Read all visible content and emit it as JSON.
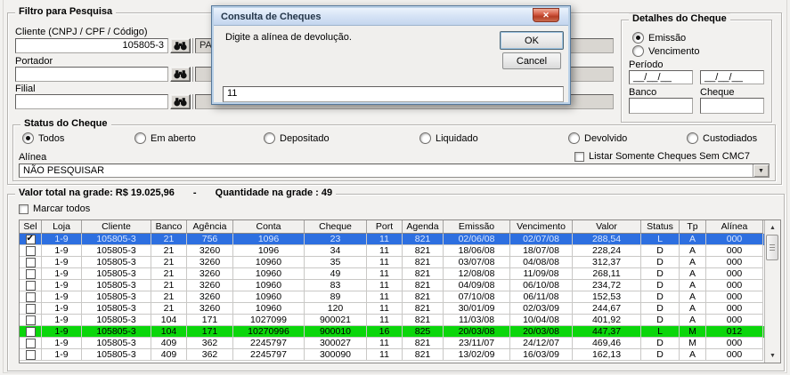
{
  "filter": {
    "title": "Filtro para Pesquisa",
    "fields": [
      {
        "label": "Cliente (CNPJ / CPF / Código)",
        "value": "105805-3",
        "detail": "PALO"
      },
      {
        "label": "Portador",
        "value": "",
        "detail": ""
      },
      {
        "label": "Filial",
        "value": "",
        "detail": ""
      }
    ]
  },
  "dialog": {
    "title": "Consulta de Cheques",
    "message": "Digite a alínea de devolução.",
    "ok": "OK",
    "cancel": "Cancel",
    "close": "✕",
    "input_value": "11"
  },
  "details": {
    "title": "Detalhes do Cheque",
    "options": [
      {
        "label": "Emissão",
        "selected": true
      },
      {
        "label": "Vencimento",
        "selected": false
      }
    ],
    "periodo_label": "Período",
    "date_from": "__/__/__",
    "date_to": "__/__/__",
    "banco_label": "Banco",
    "cheque_label": "Cheque",
    "banco_value": "",
    "cheque_value": ""
  },
  "status": {
    "title": "Status do Cheque",
    "options": [
      {
        "label": "Todos",
        "selected": true
      },
      {
        "label": "Em aberto",
        "selected": false
      },
      {
        "label": "Depositado",
        "selected": false
      },
      {
        "label": "Liquidado",
        "selected": false
      },
      {
        "label": "Devolvido",
        "selected": false
      },
      {
        "label": "Custodiados",
        "selected": false
      }
    ],
    "alinea_label": "Alínea",
    "alinea_value": "NÃO PESQUISAR",
    "cmc7_label": "Listar Somente Cheques Sem CMC7",
    "cmc7_checked": false
  },
  "grid": {
    "total_label": "Valor total na grade: R$ 19.025,96",
    "separator": "-",
    "count_label": "Quantidade na grade : 49",
    "select_all_label": "Marcar todos",
    "select_all_checked": false,
    "selected_row_color": "#2d6fe0",
    "highlight_row_color": "#0bd60b",
    "columns": [
      "Sel",
      "Loja",
      "Cliente",
      "Banco",
      "Agência",
      "Conta",
      "Cheque",
      "Port",
      "Agenda",
      "Emissão",
      "Vencimento",
      "Valor",
      "Status",
      "Tp",
      "Alínea"
    ],
    "rows": [
      {
        "checked": true,
        "state": "selected",
        "cells": [
          "1-9",
          "105805-3",
          "21",
          "756",
          "1096",
          "23",
          "11",
          "821",
          "02/06/08",
          "02/07/08",
          "288,54",
          "L",
          "A",
          "000"
        ]
      },
      {
        "checked": false,
        "state": "normal",
        "cells": [
          "1-9",
          "105805-3",
          "21",
          "3260",
          "1096",
          "34",
          "11",
          "821",
          "18/06/08",
          "18/07/08",
          "228,24",
          "D",
          "A",
          "000"
        ]
      },
      {
        "checked": false,
        "state": "normal",
        "cells": [
          "1-9",
          "105805-3",
          "21",
          "3260",
          "10960",
          "35",
          "11",
          "821",
          "03/07/08",
          "04/08/08",
          "312,37",
          "D",
          "A",
          "000"
        ]
      },
      {
        "checked": false,
        "state": "normal",
        "cells": [
          "1-9",
          "105805-3",
          "21",
          "3260",
          "10960",
          "49",
          "11",
          "821",
          "12/08/08",
          "11/09/08",
          "268,11",
          "D",
          "A",
          "000"
        ]
      },
      {
        "checked": false,
        "state": "normal",
        "cells": [
          "1-9",
          "105805-3",
          "21",
          "3260",
          "10960",
          "83",
          "11",
          "821",
          "04/09/08",
          "06/10/08",
          "234,72",
          "D",
          "A",
          "000"
        ]
      },
      {
        "checked": false,
        "state": "normal",
        "cells": [
          "1-9",
          "105805-3",
          "21",
          "3260",
          "10960",
          "89",
          "11",
          "821",
          "07/10/08",
          "06/11/08",
          "152,53",
          "D",
          "A",
          "000"
        ]
      },
      {
        "checked": false,
        "state": "normal",
        "cells": [
          "1-9",
          "105805-3",
          "21",
          "3260",
          "10960",
          "120",
          "11",
          "821",
          "30/01/09",
          "02/03/09",
          "244,67",
          "D",
          "A",
          "000"
        ]
      },
      {
        "checked": false,
        "state": "normal",
        "cells": [
          "1-9",
          "105805-3",
          "104",
          "171",
          "1027099",
          "900021",
          "11",
          "821",
          "11/03/08",
          "10/04/08",
          "401,92",
          "D",
          "A",
          "000"
        ]
      },
      {
        "checked": false,
        "state": "green",
        "cells": [
          "1-9",
          "105805-3",
          "104",
          "171",
          "10270996",
          "900010",
          "16",
          "825",
          "20/03/08",
          "20/03/08",
          "447,37",
          "L",
          "M",
          "012"
        ]
      },
      {
        "checked": false,
        "state": "normal",
        "cells": [
          "1-9",
          "105805-3",
          "409",
          "362",
          "2245797",
          "300027",
          "11",
          "821",
          "23/11/07",
          "24/12/07",
          "469,46",
          "D",
          "M",
          "000"
        ]
      },
      {
        "checked": false,
        "state": "normal",
        "cells": [
          "1-9",
          "105805-3",
          "409",
          "362",
          "2245797",
          "300090",
          "11",
          "821",
          "13/02/09",
          "16/03/09",
          "162,13",
          "D",
          "A",
          "000"
        ]
      }
    ]
  }
}
